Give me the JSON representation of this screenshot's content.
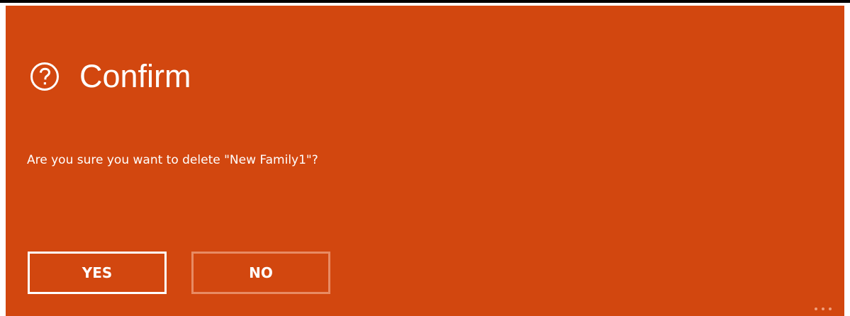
{
  "dialog": {
    "icon": "help-circle-icon",
    "title": "Confirm",
    "message": "Are you sure you want to delete \"New Family1\"?",
    "yes_label": "YES",
    "no_label": "NO",
    "more_icon": "more-ellipsis-icon"
  },
  "colors": {
    "background": "#d2470f",
    "text": "#ffffff",
    "yes_border": "#ffffff",
    "no_border": "#e88b64"
  }
}
